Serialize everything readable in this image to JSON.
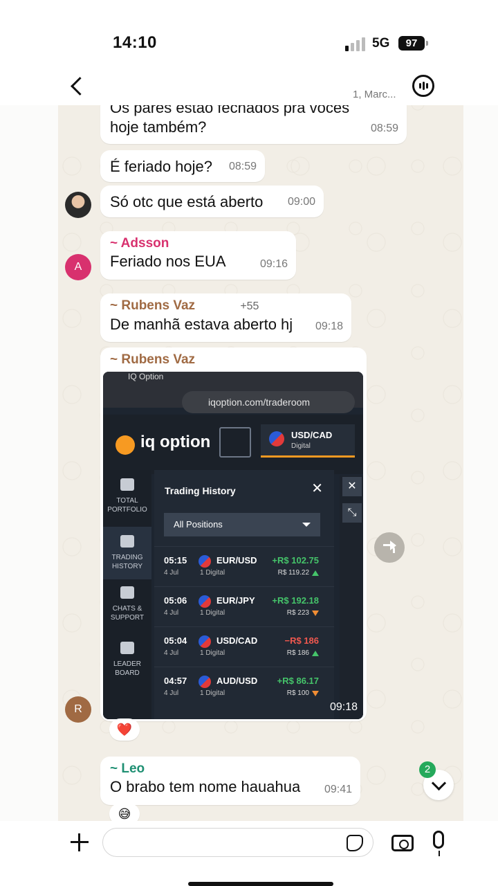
{
  "status_bar": {
    "time": "14:10",
    "network": "5G",
    "battery": "97"
  },
  "header": {
    "subtitle": "1, Marc..."
  },
  "messages": [
    {
      "text": "Os pares estão fechados pra vocês hoje também?",
      "time": "08:59"
    },
    {
      "text": "É feriado hoje?",
      "time": "08:59"
    },
    {
      "text": "Só otc que está aberto",
      "time": "09:00"
    },
    {
      "sender": "~ Adsson",
      "avatar": "A",
      "text": "Feriado nos EUA",
      "time": "09:16"
    },
    {
      "sender": "~ Rubens Vaz",
      "phone": "+55",
      "text": "De manhã estava aberto hj",
      "time": "09:18"
    },
    {
      "sender": "~ Rubens Vaz",
      "avatar": "R",
      "time": "09:18",
      "reaction": "❤️"
    },
    {
      "sender": "~ Leo",
      "text": "O brabo tem nome hauahua",
      "time": "09:41",
      "reaction": "😅"
    }
  ],
  "screenshot": {
    "tab_title": "IQ Option",
    "url": "iqoption.com/traderoom",
    "brand": "iq option",
    "active_pair": "USD/CAD",
    "active_pair_type": "Digital",
    "sidebar": [
      {
        "label": "TOTAL PORTFOLIO"
      },
      {
        "label": "TRADING HISTORY"
      },
      {
        "label": "CHATS & SUPPORT"
      },
      {
        "label": "LEADER BOARD"
      }
    ],
    "panel_title": "Trading History",
    "filter": "All Positions",
    "trades": [
      {
        "time": "05:15",
        "date": "4 Jul",
        "pair": "EUR/USD",
        "kind": "1 Digital",
        "pl": "+R$ 102.75",
        "invest": "R$ 119.22",
        "dir": "up",
        "pl_color": "#45c46a"
      },
      {
        "time": "05:06",
        "date": "4 Jul",
        "pair": "EUR/JPY",
        "kind": "1 Digital",
        "pl": "+R$ 192.18",
        "invest": "R$ 223",
        "dir": "down",
        "pl_color": "#45c46a"
      },
      {
        "time": "05:04",
        "date": "4 Jul",
        "pair": "USD/CAD",
        "kind": "1 Digital",
        "pl": "−R$ 186",
        "invest": "R$ 186",
        "dir": "up",
        "pl_color": "#f0584f"
      },
      {
        "time": "04:57",
        "date": "4 Jul",
        "pair": "AUD/USD",
        "kind": "1 Digital",
        "pl": "+R$ 86.17",
        "invest": "R$ 100",
        "dir": "down",
        "pl_color": "#45c46a"
      }
    ]
  },
  "unread_count": "2",
  "colors": {
    "adsson": "#d8316e",
    "rubens": "#a06a43",
    "leo": "#1e8f72",
    "wallpaper": "#f2eee6"
  }
}
